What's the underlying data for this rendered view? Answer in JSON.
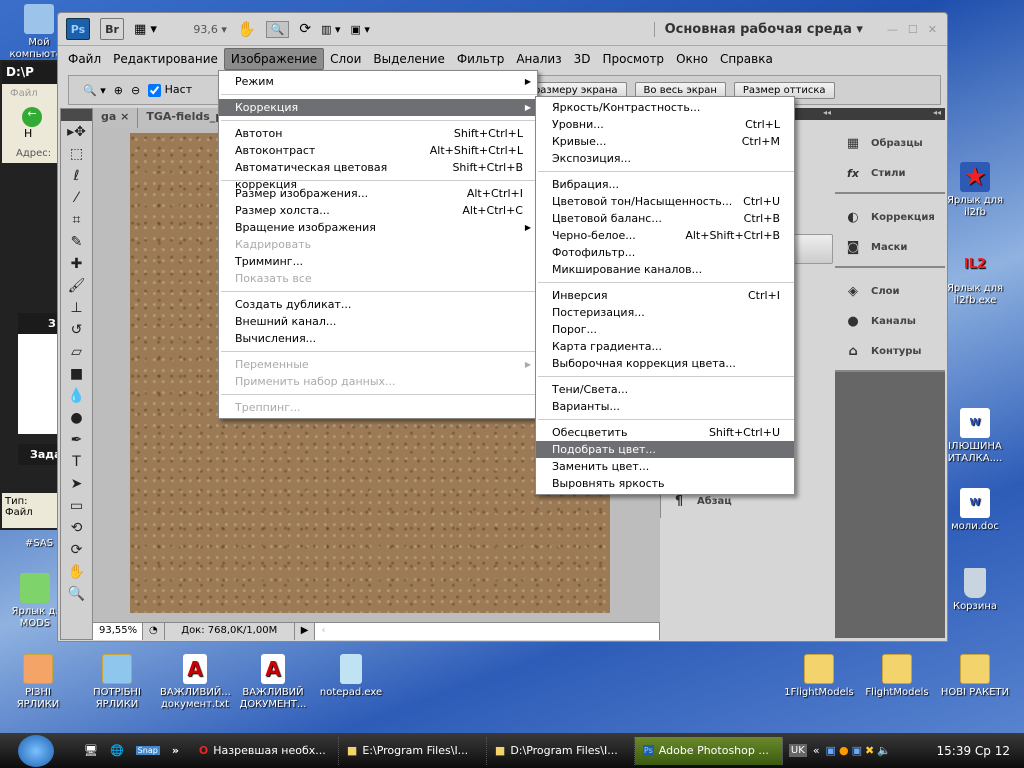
{
  "desktop": {
    "left_icons": [
      "Мой компьютер",
      "#SAS",
      "Ярлык д. MODS"
    ],
    "right_icons": [
      "Ярлык для il2fb",
      "Ярлык для il2fb.exe",
      "ІЛЮШИНА ИТАЛКА....",
      "моли.doc",
      "Корзина"
    ],
    "bottom_icons": [
      "РІЗНІ ЯРЛИКИ",
      "ПОТРІБНІ ЯРЛИКИ",
      "ВАЖЛИВИЙ... документ.txt",
      "ВАЖЛИВИЙ ДОКУМЕНТ...",
      "notepad.exe"
    ],
    "bottom_right_icons": [
      "1FlightModels",
      "FlightModels",
      "НОВІ РАКЕТИ"
    ]
  },
  "explorer": {
    "title": "D:\\P",
    "menu": "Файл",
    "back": "Н",
    "address": "Адрес:",
    "task1": "З",
    "task2": "Зада",
    "type": "Тип: Файл"
  },
  "ps": {
    "ps_logo": "Ps",
    "br_logo": "Br",
    "zoom": "93,6",
    "workspace": "Основная рабочая среда",
    "menu": [
      "Файл",
      "Редактирование",
      "Изображение",
      "Слои",
      "Выделение",
      "Фильтр",
      "Анализ",
      "3D",
      "Просмотр",
      "Окно",
      "Справка"
    ],
    "options": {
      "checkbox_label": "Наст",
      "fit_screen": "По размеру экрана",
      "full_screen": "Во весь экран",
      "print_size": "Размер оттиска"
    },
    "tabs": [
      "ga ×",
      "TGA-fields_p"
    ],
    "status": {
      "zoom": "93,55%",
      "doc": "Док: 768,0K/1,00M"
    },
    "panels": [
      "Образцы",
      "Стили",
      "Коррекция",
      "Маски",
      "Слои",
      "Каналы",
      "Контуры"
    ],
    "panel_paragraph": "Абзац"
  },
  "image_menu": [
    {
      "label": "Режим",
      "sub": true
    },
    {
      "sep": true
    },
    {
      "label": "Коррекция",
      "sub": true,
      "hi": true
    },
    {
      "sep": true
    },
    {
      "label": "Автотон",
      "key": "Shift+Ctrl+L"
    },
    {
      "label": "Автоконтраст",
      "key": "Alt+Shift+Ctrl+L"
    },
    {
      "label": "Автоматическая цветовая коррекция",
      "key": "Shift+Ctrl+B"
    },
    {
      "sep": true
    },
    {
      "label": "Размер изображения...",
      "key": "Alt+Ctrl+I"
    },
    {
      "label": "Размер холста...",
      "key": "Alt+Ctrl+C"
    },
    {
      "label": "Вращение изображения",
      "sub": true
    },
    {
      "label": "Кадрировать",
      "dis": true
    },
    {
      "label": "Тримминг..."
    },
    {
      "label": "Показать все",
      "dis": true
    },
    {
      "sep": true
    },
    {
      "label": "Создать дубликат..."
    },
    {
      "label": "Внешний канал..."
    },
    {
      "label": "Вычисления..."
    },
    {
      "sep": true
    },
    {
      "label": "Переменные",
      "dis": true,
      "sub": true
    },
    {
      "label": "Применить набор данных...",
      "dis": true
    },
    {
      "sep": true
    },
    {
      "label": "Треппинг...",
      "dis": true
    }
  ],
  "correction_menu": [
    {
      "label": "Яркость/Контрастность..."
    },
    {
      "label": "Уровни...",
      "key": "Ctrl+L"
    },
    {
      "label": "Кривые...",
      "key": "Ctrl+M"
    },
    {
      "label": "Экспозиция..."
    },
    {
      "sep": true
    },
    {
      "label": "Вибрация..."
    },
    {
      "label": "Цветовой тон/Насыщенность...",
      "key": "Ctrl+U"
    },
    {
      "label": "Цветовой баланс...",
      "key": "Ctrl+B"
    },
    {
      "label": "Черно-белое...",
      "key": "Alt+Shift+Ctrl+B"
    },
    {
      "label": "Фотофильтр..."
    },
    {
      "label": "Микширование каналов..."
    },
    {
      "sep": true
    },
    {
      "label": "Инверсия",
      "key": "Ctrl+I"
    },
    {
      "label": "Постеризация..."
    },
    {
      "label": "Порог..."
    },
    {
      "label": "Карта градиента..."
    },
    {
      "label": "Выборочная коррекция цвета..."
    },
    {
      "sep": true
    },
    {
      "label": "Тени/Света..."
    },
    {
      "label": "Варианты..."
    },
    {
      "sep": true
    },
    {
      "label": "Обесцветить",
      "key": "Shift+Ctrl+U"
    },
    {
      "label": "Подобрать цвет...",
      "hi": true
    },
    {
      "label": "Заменить цвет..."
    },
    {
      "label": "Выровнять яркость"
    }
  ],
  "taskbar": {
    "more": "»",
    "tasks": [
      "Назревшая необх...",
      "E:\\Program Files\\I...",
      "D:\\Program Files\\I...",
      "Adobe Photoshop ..."
    ],
    "lang": "UK",
    "tray_more": "«",
    "clock": "15:39 Ср 12"
  }
}
